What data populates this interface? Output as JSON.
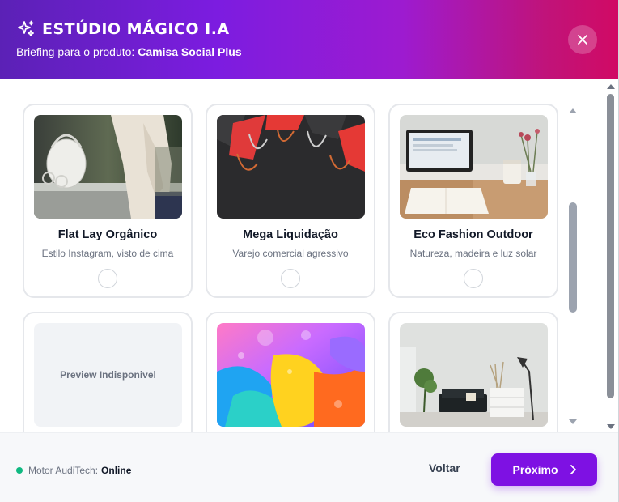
{
  "header": {
    "title": "ESTÚDIO MÁGICO I.A",
    "subtitle_prefix": "Briefing para o produto: ",
    "product_name": "Camisa Social Plus",
    "close_icon": "close-icon",
    "sparkle_icon": "sparkles-icon"
  },
  "styles": [
    {
      "name": "Flat Lay Orgânico",
      "description": "Estilo Instagram, visto de cima",
      "image": "woman-bag-photo"
    },
    {
      "name": "Mega Liquidação",
      "description": "Varejo comercial agressivo",
      "image": "shopping-bags-photo"
    },
    {
      "name": "Eco Fashion Outdoor",
      "description": "Natureza, madeira e luz solar",
      "image": "laptop-desk-photo"
    },
    {
      "preview_text": "Preview Indisponivel"
    },
    {
      "image": "colorful-abstract-photo"
    },
    {
      "image": "living-room-photo"
    }
  ],
  "footer": {
    "status_label": "Motor AudiTech:",
    "status_value": "Online",
    "back_label": "Voltar",
    "next_label": "Próximo"
  },
  "colors": {
    "accent": "#7e11e3",
    "status_online": "#10b981",
    "header_gradient_start": "#5b21b6",
    "header_gradient_end": "#d10a64"
  }
}
